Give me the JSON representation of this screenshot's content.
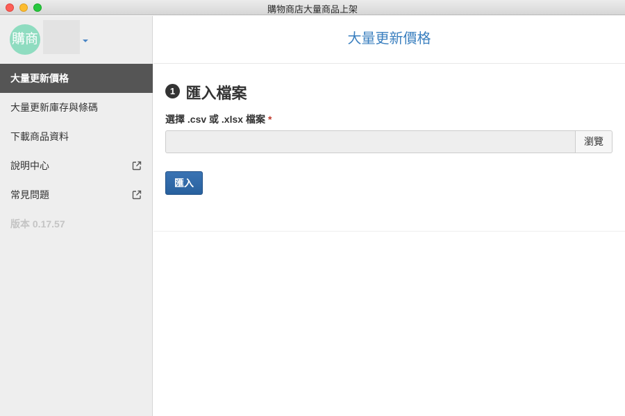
{
  "window": {
    "title": "購物商店大量商品上架"
  },
  "brand": {
    "logo_text": "購商"
  },
  "sidebar": {
    "items": [
      {
        "label": "大量更新價格"
      },
      {
        "label": "大量更新庫存與條碼"
      },
      {
        "label": "下載商品資料"
      },
      {
        "label": "說明中心",
        "icon": "external-link-icon"
      },
      {
        "label": "常見問題",
        "icon": "external-link-icon"
      },
      {
        "label": "版本 0.17.57"
      }
    ]
  },
  "main": {
    "header_title": "大量更新價格",
    "step": {
      "number": "1",
      "title": "匯入檔案"
    },
    "file_field": {
      "label": "選擇 .csv 或 .xlsx 檔案",
      "required_mark": "*",
      "value": "",
      "browse_label": "瀏覽"
    },
    "import_label": "匯入"
  },
  "colors": {
    "accent_blue": "#3a7fbf",
    "button_blue": "#28619e",
    "sidebar_active": "#555555",
    "logo_green": "#8fdcc0",
    "required_red": "#c0392b"
  }
}
